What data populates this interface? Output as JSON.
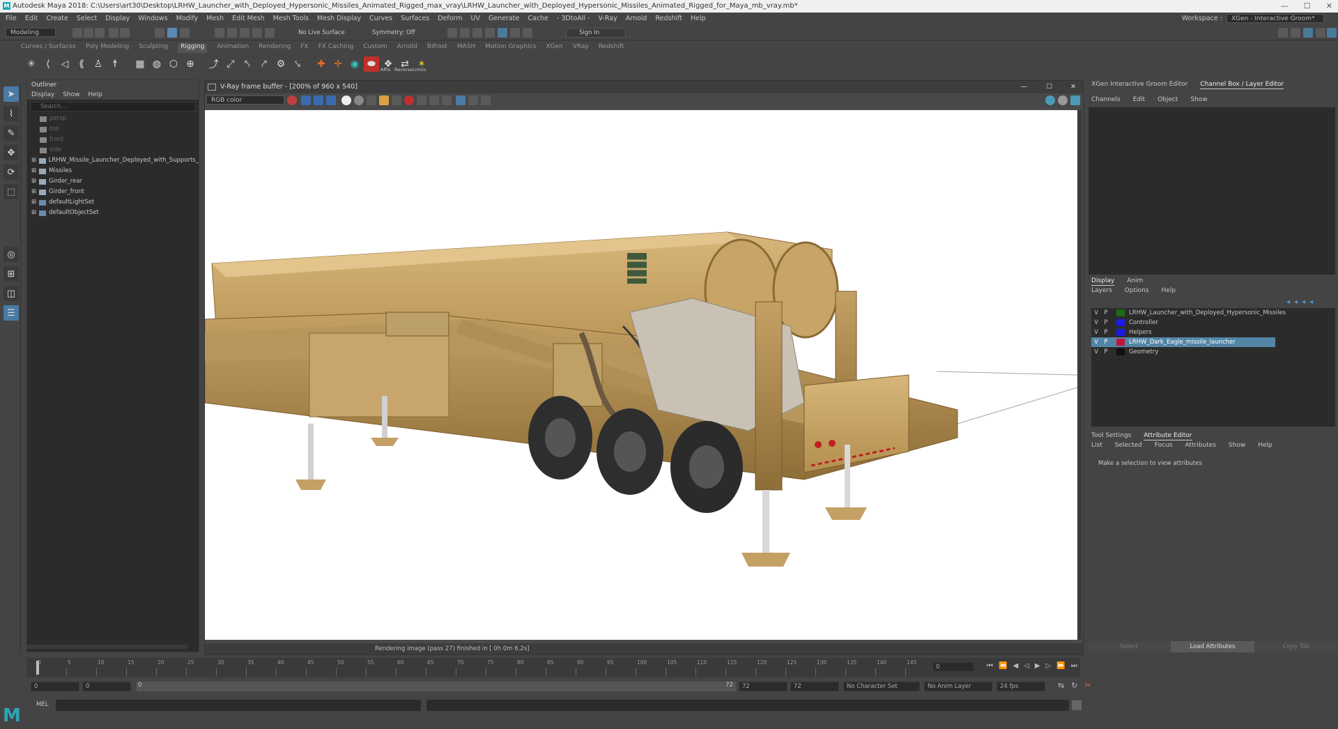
{
  "window": {
    "title": "Autodesk Maya 2018: C:\\Users\\art30\\Desktop\\LRHW_Launcher_with_Deployed_Hypersonic_Missiles_Animated_Rigged_max_vray\\LRHW_Launcher_with_Deployed_Hypersonic_Missiles_Animated_Rigged_for_Maya_mb_vray.mb*",
    "logo": "M"
  },
  "menu": [
    "File",
    "Edit",
    "Create",
    "Select",
    "Display",
    "Windows",
    "Modify",
    "Mesh",
    "Edit Mesh",
    "Mesh Tools",
    "Mesh Display",
    "Curves",
    "Surfaces",
    "Deform",
    "UV",
    "Generate",
    "Cache",
    "- 3DtoAll -",
    "V-Ray",
    "Arnold",
    "Redshift",
    "Help"
  ],
  "workspace": {
    "label": "Workspace :",
    "value": "XGen - Interactive Groom*"
  },
  "statusline": {
    "mode": "Modeling",
    "live_surface": "No Live Surface",
    "symmetry": "Symmetry: Off",
    "sign_in": "Sign In"
  },
  "shelf_tabs": [
    "Curves / Surfaces",
    "Poly Modeling",
    "Sculpting",
    "Rigging",
    "Animation",
    "Rendering",
    "FX",
    "FX Caching",
    "Custom",
    "Arnold",
    "Bifrost",
    "MASH",
    "Motion Graphics",
    "XGen",
    "VRay",
    "Redshift"
  ],
  "shelf_active": "Rigging",
  "shelf_labels": {
    "affix": "Affix",
    "reverse": "Reverse",
    "limits": "Limits"
  },
  "outliner": {
    "title": "Outliner",
    "menu": [
      "Display",
      "Show",
      "Help"
    ],
    "search_placeholder": "Search...",
    "items": [
      {
        "label": "persp",
        "dim": true
      },
      {
        "label": "top",
        "dim": true
      },
      {
        "label": "front",
        "dim": true
      },
      {
        "label": "side",
        "dim": true
      },
      {
        "label": "LRHW_Missile_Launcher_Deployed_with_Supports_",
        "dim": false
      },
      {
        "label": "Missiles",
        "dim": false
      },
      {
        "label": "Girder_rear",
        "dim": false
      },
      {
        "label": "Girder_front",
        "dim": false
      },
      {
        "label": "defaultLightSet",
        "dim": false
      },
      {
        "label": "defaultObjectSet",
        "dim": false
      }
    ]
  },
  "vfb": {
    "title": "V-Ray frame buffer - [200% of 960 x 540]",
    "channel": "RGB color",
    "status": "Rendering image (pass 27) finished in [ 0h 0m 6.2s]",
    "controls": [
      "—",
      "☐",
      "✕"
    ]
  },
  "right_panel": {
    "tabs": [
      "XGen Interactive Groom Editor",
      "Channel Box / Layer Editor"
    ],
    "channel_menu": [
      "Channels",
      "Edit",
      "Object",
      "Show"
    ],
    "layer_tabs": [
      "Display",
      "Anim"
    ],
    "layer_menu": [
      "Layers",
      "Options",
      "Help"
    ],
    "layers": [
      {
        "v": "V",
        "p": "P",
        "color": "#1a6a1a",
        "name": "LRHW_Launcher_with_Deployed_Hypersonic_Missiles",
        "selected": false
      },
      {
        "v": "V",
        "p": "P",
        "color": "#1a1ae6",
        "name": "Controller",
        "selected": false
      },
      {
        "v": "V",
        "p": "P",
        "color": "#1a1ae6",
        "name": "Helpers",
        "selected": false
      },
      {
        "v": "V",
        "p": "P",
        "color": "#c0143c",
        "name": "LRHW_Dark_Eagle_missile_launcher",
        "selected": true
      },
      {
        "v": "V",
        "p": "P",
        "color": "#111111",
        "name": "Geometry",
        "selected": false
      }
    ],
    "attr_tabs": [
      "Tool Settings",
      "Attribute Editor"
    ],
    "attr_menu": [
      "List",
      "Selected",
      "Focus",
      "Attributes",
      "Show",
      "Help"
    ],
    "attr_message": "Make a selection to view attributes",
    "bottom_buttons": [
      "Select",
      "Load Attributes",
      "Copy Tab"
    ]
  },
  "timeline": {
    "ticks": [
      "0",
      "5",
      "10",
      "15",
      "20",
      "25",
      "30",
      "35",
      "40",
      "45",
      "50",
      "55",
      "60",
      "65",
      "70",
      "75",
      "80",
      "85",
      "90",
      "95",
      "100",
      "105",
      "110",
      "115",
      "120",
      "125",
      "130",
      "135",
      "140",
      "145"
    ],
    "current": "0",
    "range_start": "0",
    "range_inner_start": "0",
    "range_slider_start": "0",
    "range_slider_end": "72",
    "range_inner_end": "72",
    "range_end": "72",
    "character_set": "No Character Set",
    "anim_layer": "No Anim Layer",
    "fps": "24 fps"
  },
  "command_line": {
    "label": "MEL"
  }
}
